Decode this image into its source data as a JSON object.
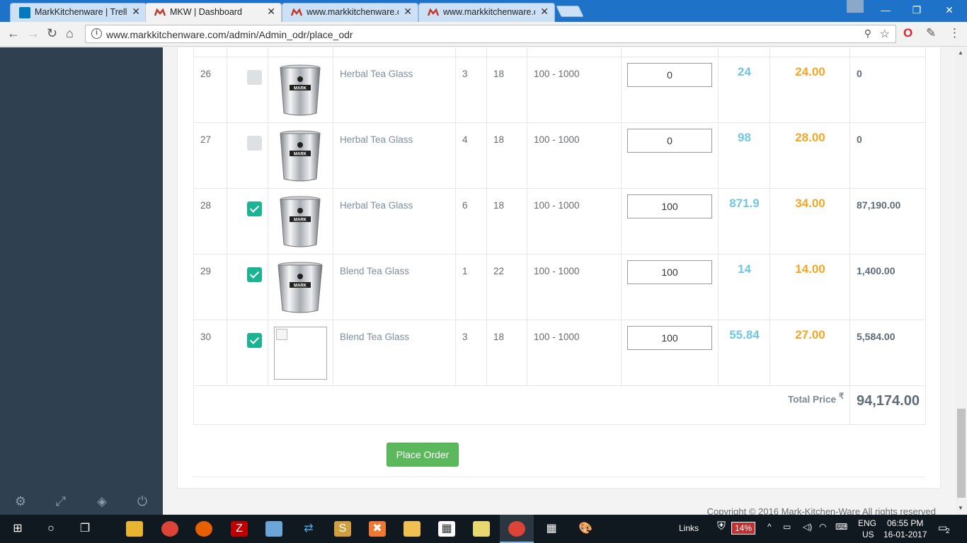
{
  "browser": {
    "tabs": [
      {
        "title": "MarkKitchenware | Trello",
        "icon": "trello-icon",
        "active": false
      },
      {
        "title": "MKW | Dashboard",
        "icon": "mkw-logo-icon",
        "active": true
      },
      {
        "title": "www.markkitchenware.co",
        "icon": "mkw-logo-icon",
        "active": false
      },
      {
        "title": "www.markkitchenware.co",
        "icon": "mkw-logo-icon",
        "active": false
      }
    ],
    "url": "www.markkitchenware.com/admin/Admin_odr/place_odr"
  },
  "orders": {
    "rows": [
      {
        "num": "26",
        "checked": false,
        "image": "steel-glass",
        "name": "Herbal Tea Glass",
        "sub": "3",
        "qty": "18",
        "range": "100 - 1000",
        "input": "0",
        "price": "24",
        "rate": "24.00",
        "total": "0"
      },
      {
        "num": "27",
        "checked": false,
        "image": "steel-glass",
        "name": "Herbal Tea Glass",
        "sub": "4",
        "qty": "18",
        "range": "100 - 1000",
        "input": "0",
        "price": "98",
        "rate": "28.00",
        "total": "0"
      },
      {
        "num": "28",
        "checked": true,
        "image": "steel-glass",
        "name": "Herbal Tea Glass",
        "sub": "6",
        "qty": "18",
        "range": "100 - 1000",
        "input": "100",
        "price": "871.9",
        "rate": "34.00",
        "total": "87,190.00"
      },
      {
        "num": "29",
        "checked": true,
        "image": "steel-glass-wide",
        "name": "Blend Tea Glass",
        "sub": "1",
        "qty": "22",
        "range": "100 - 1000",
        "input": "100",
        "price": "14",
        "rate": "14.00",
        "total": "1,400.00"
      },
      {
        "num": "30",
        "checked": true,
        "image": "broken",
        "name": "Blend Tea Glass",
        "sub": "3",
        "qty": "18",
        "range": "100 - 1000",
        "input": "100",
        "price": "55.84",
        "rate": "27.00",
        "total": "5,584.00"
      }
    ],
    "total_label": "Total Price",
    "currency_symbol": "₹",
    "total_value": "94,174.00",
    "place_order_label": "Place Order"
  },
  "footer": {
    "copyright": "Copyright © 2016 Mark-Kitchen-Ware All rights reserved"
  },
  "taskbar": {
    "links_label": "Links",
    "battery": "14%",
    "lang": "ENG",
    "region": "US",
    "time": "06:55 PM",
    "date": "16-01-2017",
    "notifications": "2"
  },
  "colors": {
    "sidebar": "#2f4050",
    "accent_green": "#1ab394",
    "price_blue": "#70c6e5",
    "rate_orange": "#f5a623",
    "button_green": "#5cb85c"
  }
}
